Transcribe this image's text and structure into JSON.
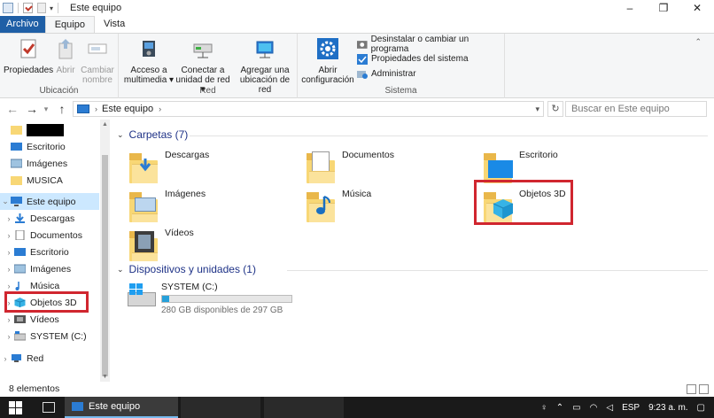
{
  "window": {
    "title": "Este equipo",
    "controls": [
      "–",
      "❐",
      "✕"
    ]
  },
  "ribbon_tabs": [
    "Archivo",
    "Equipo",
    "Vista"
  ],
  "ribbon": {
    "ubicacion": {
      "label": "Ubicación",
      "propiedades": "Propiedades",
      "abrir": "Abrir",
      "cambiar_nombre_1": "Cambiar",
      "cambiar_nombre_2": "nombre"
    },
    "red": {
      "label": "Red",
      "acceso_1": "Acceso a",
      "acceso_2": "multimedia ▾",
      "conectar_1": "Conectar a",
      "conectar_2": "unidad de red ▾",
      "agregar_1": "Agregar una",
      "agregar_2": "ubicación de red"
    },
    "sistema": {
      "label": "Sistema",
      "abrir_config_1": "Abrir",
      "abrir_config_2": "configuración",
      "desinstalar": "Desinstalar o cambiar un programa",
      "propiedades_sistema": "Propiedades del sistema",
      "administrar": "Administrar"
    }
  },
  "address": {
    "path": "Este equipo",
    "search_placeholder": "Buscar en Este equipo"
  },
  "nav": {
    "quick_items": [
      "",
      "Escritorio",
      "Imágenes",
      "MUSICA"
    ],
    "this_pc": "Este equipo",
    "pc_children": [
      "Descargas",
      "Documentos",
      "Escritorio",
      "Imágenes",
      "Música",
      "Objetos 3D",
      "Vídeos",
      "SYSTEM (C:)"
    ],
    "network": "Red"
  },
  "content": {
    "folders_header": "Carpetas (7)",
    "folders": [
      "Descargas",
      "Documentos",
      "Escritorio",
      "Imágenes",
      "Música",
      "Objetos 3D",
      "Vídeos"
    ],
    "devices_header": "Dispositivos y unidades (1)",
    "drive": {
      "name": "SYSTEM (C:)",
      "free": "280 GB disponibles de 297 GB",
      "used_fraction": 0.057
    }
  },
  "status": {
    "count": "8 elementos"
  },
  "taskbar": {
    "app": "Este equipo",
    "lang": "ESP",
    "time": "9:23 a. m."
  },
  "colors": {
    "highlight": "#d0262f",
    "accent": "#1f5fa6",
    "selection": "#cce8ff"
  }
}
